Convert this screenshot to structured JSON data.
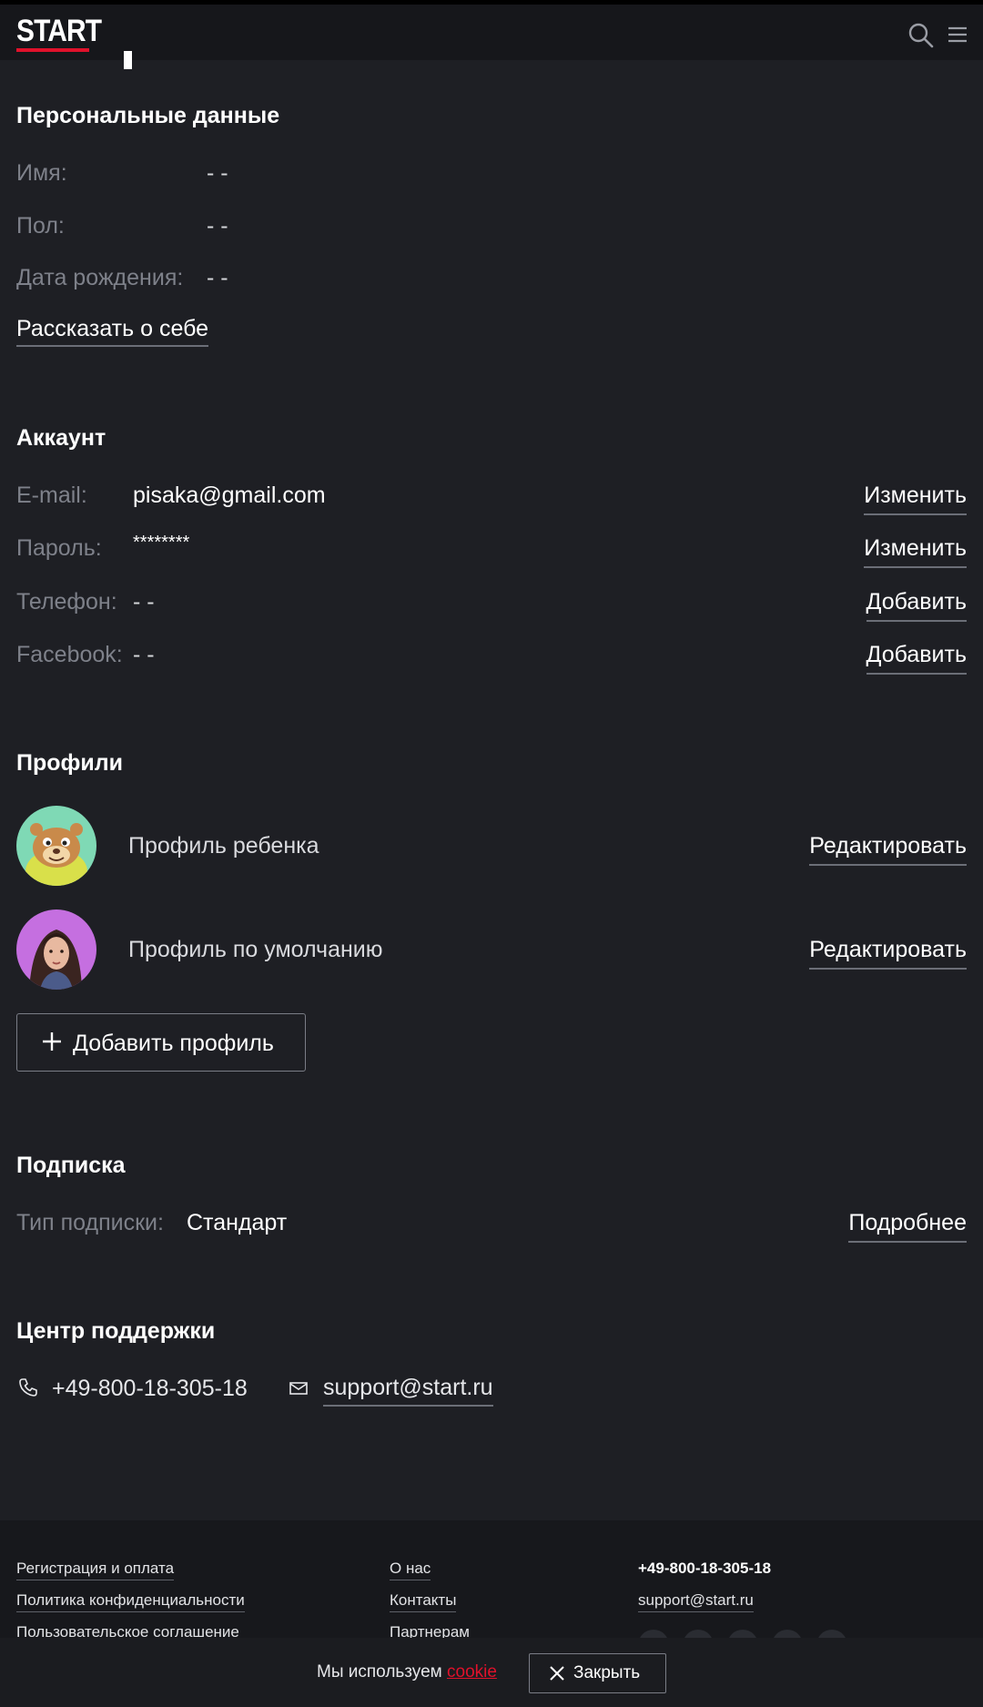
{
  "header": {
    "logo": "START",
    "search_icon": "search-icon",
    "menu_icon": "menu-icon"
  },
  "personal": {
    "title": "Персональные данные",
    "fields": [
      {
        "label": "Имя:",
        "value": "- -"
      },
      {
        "label": "Пол:",
        "value": "- -"
      },
      {
        "label": "Дата рождения:",
        "value": "- -"
      }
    ],
    "about_link": "Рассказать о себе"
  },
  "account": {
    "title": "Аккаунт",
    "fields": [
      {
        "label": "E-mail:",
        "value": "pisaka@gmail.com",
        "action": "Изменить"
      },
      {
        "label": "Пароль:",
        "value": "********",
        "action": "Изменить"
      },
      {
        "label": "Телефон:",
        "value": "- -",
        "action": "Добавить"
      },
      {
        "label": "Facebook:",
        "value": "- -",
        "action": "Добавить"
      }
    ]
  },
  "profiles": {
    "title": "Профили",
    "items": [
      {
        "name": "Профиль ребенка",
        "action": "Редактировать",
        "avatar": "child-avatar"
      },
      {
        "name": "Профиль по умолчанию",
        "action": "Редактировать",
        "avatar": "default-avatar"
      }
    ],
    "add_button": "Добавить профиль"
  },
  "subscription": {
    "title": "Подписка",
    "label": "Тип подписки:",
    "value": "Стандарт",
    "action": "Подробнее"
  },
  "support": {
    "title": "Центр поддержки",
    "phone": "+49-800-18-305-18",
    "email": "support@start.ru"
  },
  "footer": {
    "col1": [
      "Регистрация и оплата",
      "Политика конфиденциальности",
      "Пользовательское соглашение"
    ],
    "col2": [
      "О нас",
      "Контакты",
      "Партнерам"
    ],
    "phone": "+49-800-18-305-18",
    "email": "support@start.ru"
  },
  "cookie": {
    "text": "Мы используем",
    "link": "cookie",
    "close": "Закрыть"
  },
  "colors": {
    "background": "#1e1f24",
    "accent": "#e0112b",
    "muted_label": "#7e818a"
  }
}
